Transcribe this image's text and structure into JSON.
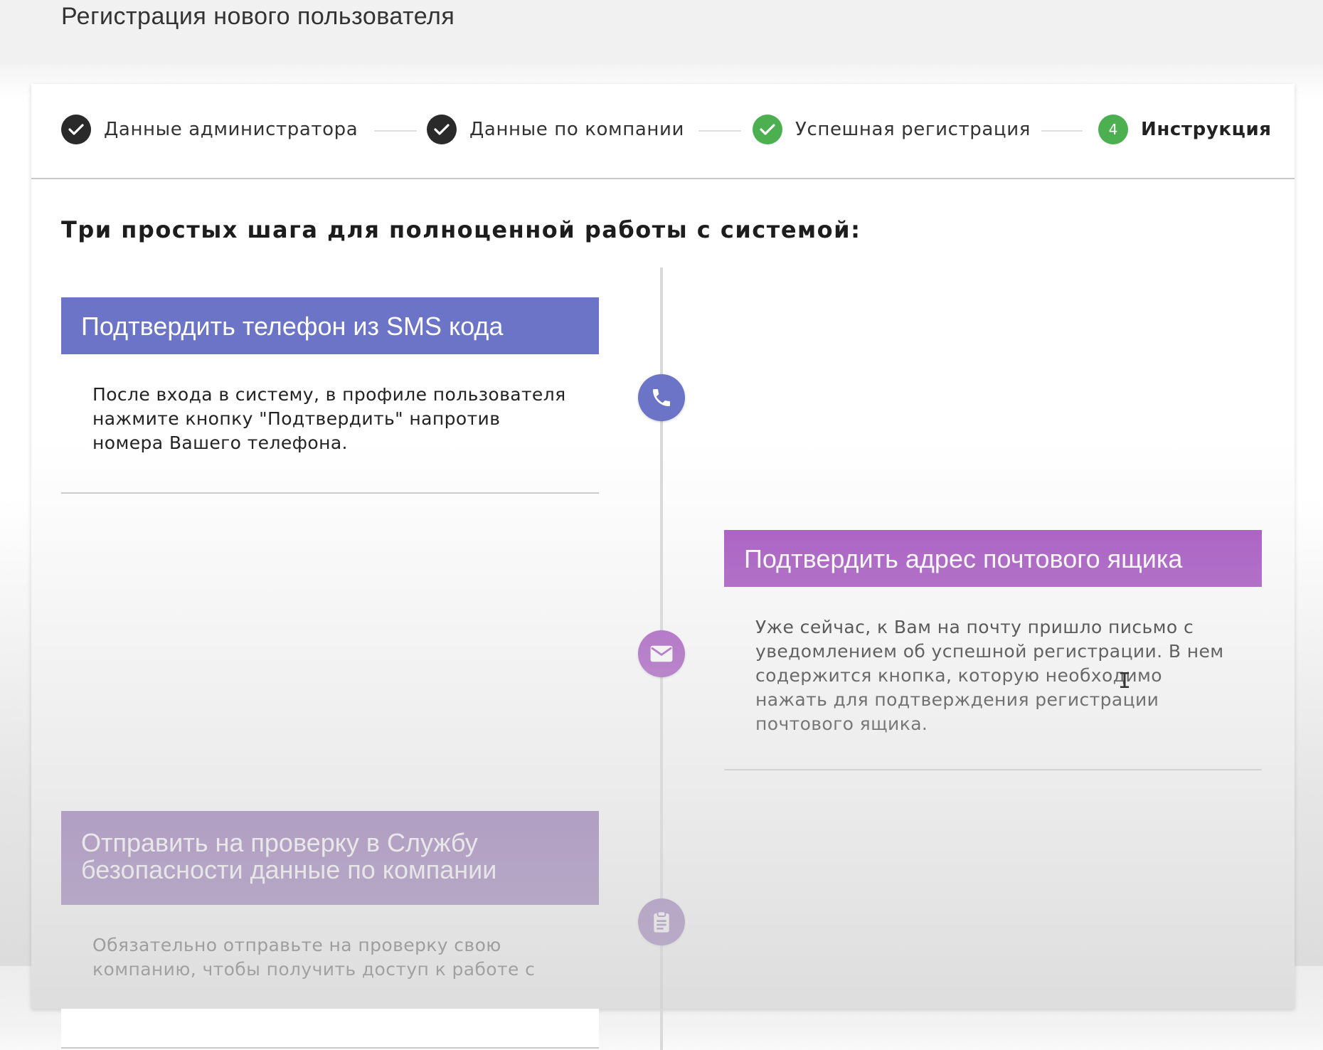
{
  "page_title": "Регистрация нового пользователя",
  "stepper": {
    "steps": [
      {
        "label": "Данные администратора",
        "state": "done",
        "icon": "check-icon"
      },
      {
        "label": "Данные по компании",
        "state": "done",
        "icon": "check-icon"
      },
      {
        "label": "Успешная регистрация",
        "state": "success",
        "icon": "check-icon"
      },
      {
        "label": "Инструкция",
        "state": "active",
        "number": "4"
      }
    ]
  },
  "heading": "Три простых шага для полноценной работы с системой:",
  "timeline": [
    {
      "title": "Подтвердить телефон из SMS кода",
      "body": "После входа в систему, в профиле пользователя нажмите кнопку \"Подтвердить\" напротив номера Вашего телефона.",
      "color": "#6b74c6",
      "icon": "phone-icon"
    },
    {
      "title": "Подтвердить адрес почтового ящика",
      "body": "Уже сейчас, к Вам на почту пришло письмо с уведомлением об успешной регистрации. В нем содержится кнопка, которую необходимо нажать для подтверждения регистрации почтового ящика.",
      "color": "#a450c0",
      "icon": "mail-icon"
    },
    {
      "title": "Отправить на проверку в Службу безопасности данные по компании",
      "body": "Обязательно отправьте на проверку свою компанию, чтобы получить доступ к работе с",
      "color": "#7a4ea6",
      "icon": "clipboard-icon"
    }
  ],
  "colors": {
    "green": "#4caf50",
    "dark": "#2a2a2a",
    "step1_header": "#6b74c6",
    "step2_header": "#a450c0",
    "step3_header": "#7a4ea6"
  }
}
